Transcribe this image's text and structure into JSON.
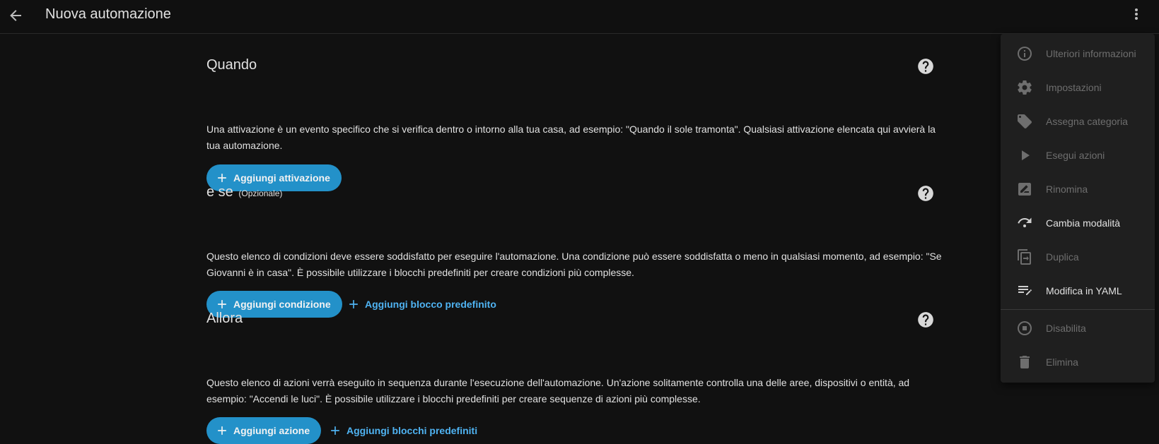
{
  "header": {
    "title": "Nuova automazione",
    "back_icon": "arrow-left-icon",
    "more_icon": "dots-vertical-icon"
  },
  "sections": [
    {
      "title": "Quando",
      "description": "Una attivazione è un evento specifico che si verifica dentro o intorno alla tua casa, ad esempio: \"Quando il sole tramonta\". Qualsiasi attivazione elencata qui avvierà la tua automazione.",
      "primary_button": "Aggiungi attivazione"
    },
    {
      "title": "e se",
      "optional_label": "(Opzionale)",
      "description": "Questo elenco di condizioni deve essere soddisfatto per eseguire l'automazione. Una condizione può essere soddisfatta o meno in qualsiasi momento, ad esempio: \"Se Giovanni è in casa\". È possibile utilizzare i blocchi predefiniti per creare condizioni più complesse.",
      "primary_button": "Aggiungi condizione",
      "secondary_button": "Aggiungi blocco predefinito"
    },
    {
      "title": "Allora",
      "description": "Questo elenco di azioni verrà eseguito in sequenza durante l'esecuzione dell'automazione. Un'azione solitamente controlla una delle aree, dispositivi o entità, ad esempio: \"Accendi le luci\". È possibile utilizzare i blocchi predefiniti per creare sequenze di azioni più complesse.",
      "primary_button": "Aggiungi azione",
      "secondary_button": "Aggiungi blocchi predefiniti"
    }
  ],
  "menu": {
    "items": [
      {
        "label": "Ulteriori informazioni",
        "icon": "information-icon",
        "enabled": false
      },
      {
        "label": "Impostazioni",
        "icon": "cog-icon",
        "enabled": false
      },
      {
        "label": "Assegna categoria",
        "icon": "tag-icon",
        "enabled": false
      },
      {
        "label": "Esegui azioni",
        "icon": "play-icon",
        "enabled": false
      },
      {
        "label": "Rinomina",
        "icon": "rename-icon",
        "enabled": false
      },
      {
        "label": "Cambia modalità",
        "icon": "redo-icon",
        "enabled": true
      },
      {
        "label": "Duplica",
        "icon": "duplicate-icon",
        "enabled": false
      },
      {
        "label": "Modifica in YAML",
        "icon": "text-edit-icon",
        "enabled": true
      },
      {
        "label": "Disabilita",
        "icon": "stop-circle-icon",
        "enabled": false
      },
      {
        "label": "Elimina",
        "icon": "delete-icon",
        "enabled": false
      }
    ]
  },
  "colors": {
    "background": "#111111",
    "accent": "#2391c9",
    "link": "#4fb3f2",
    "menu_bg": "#1f1f1f"
  }
}
